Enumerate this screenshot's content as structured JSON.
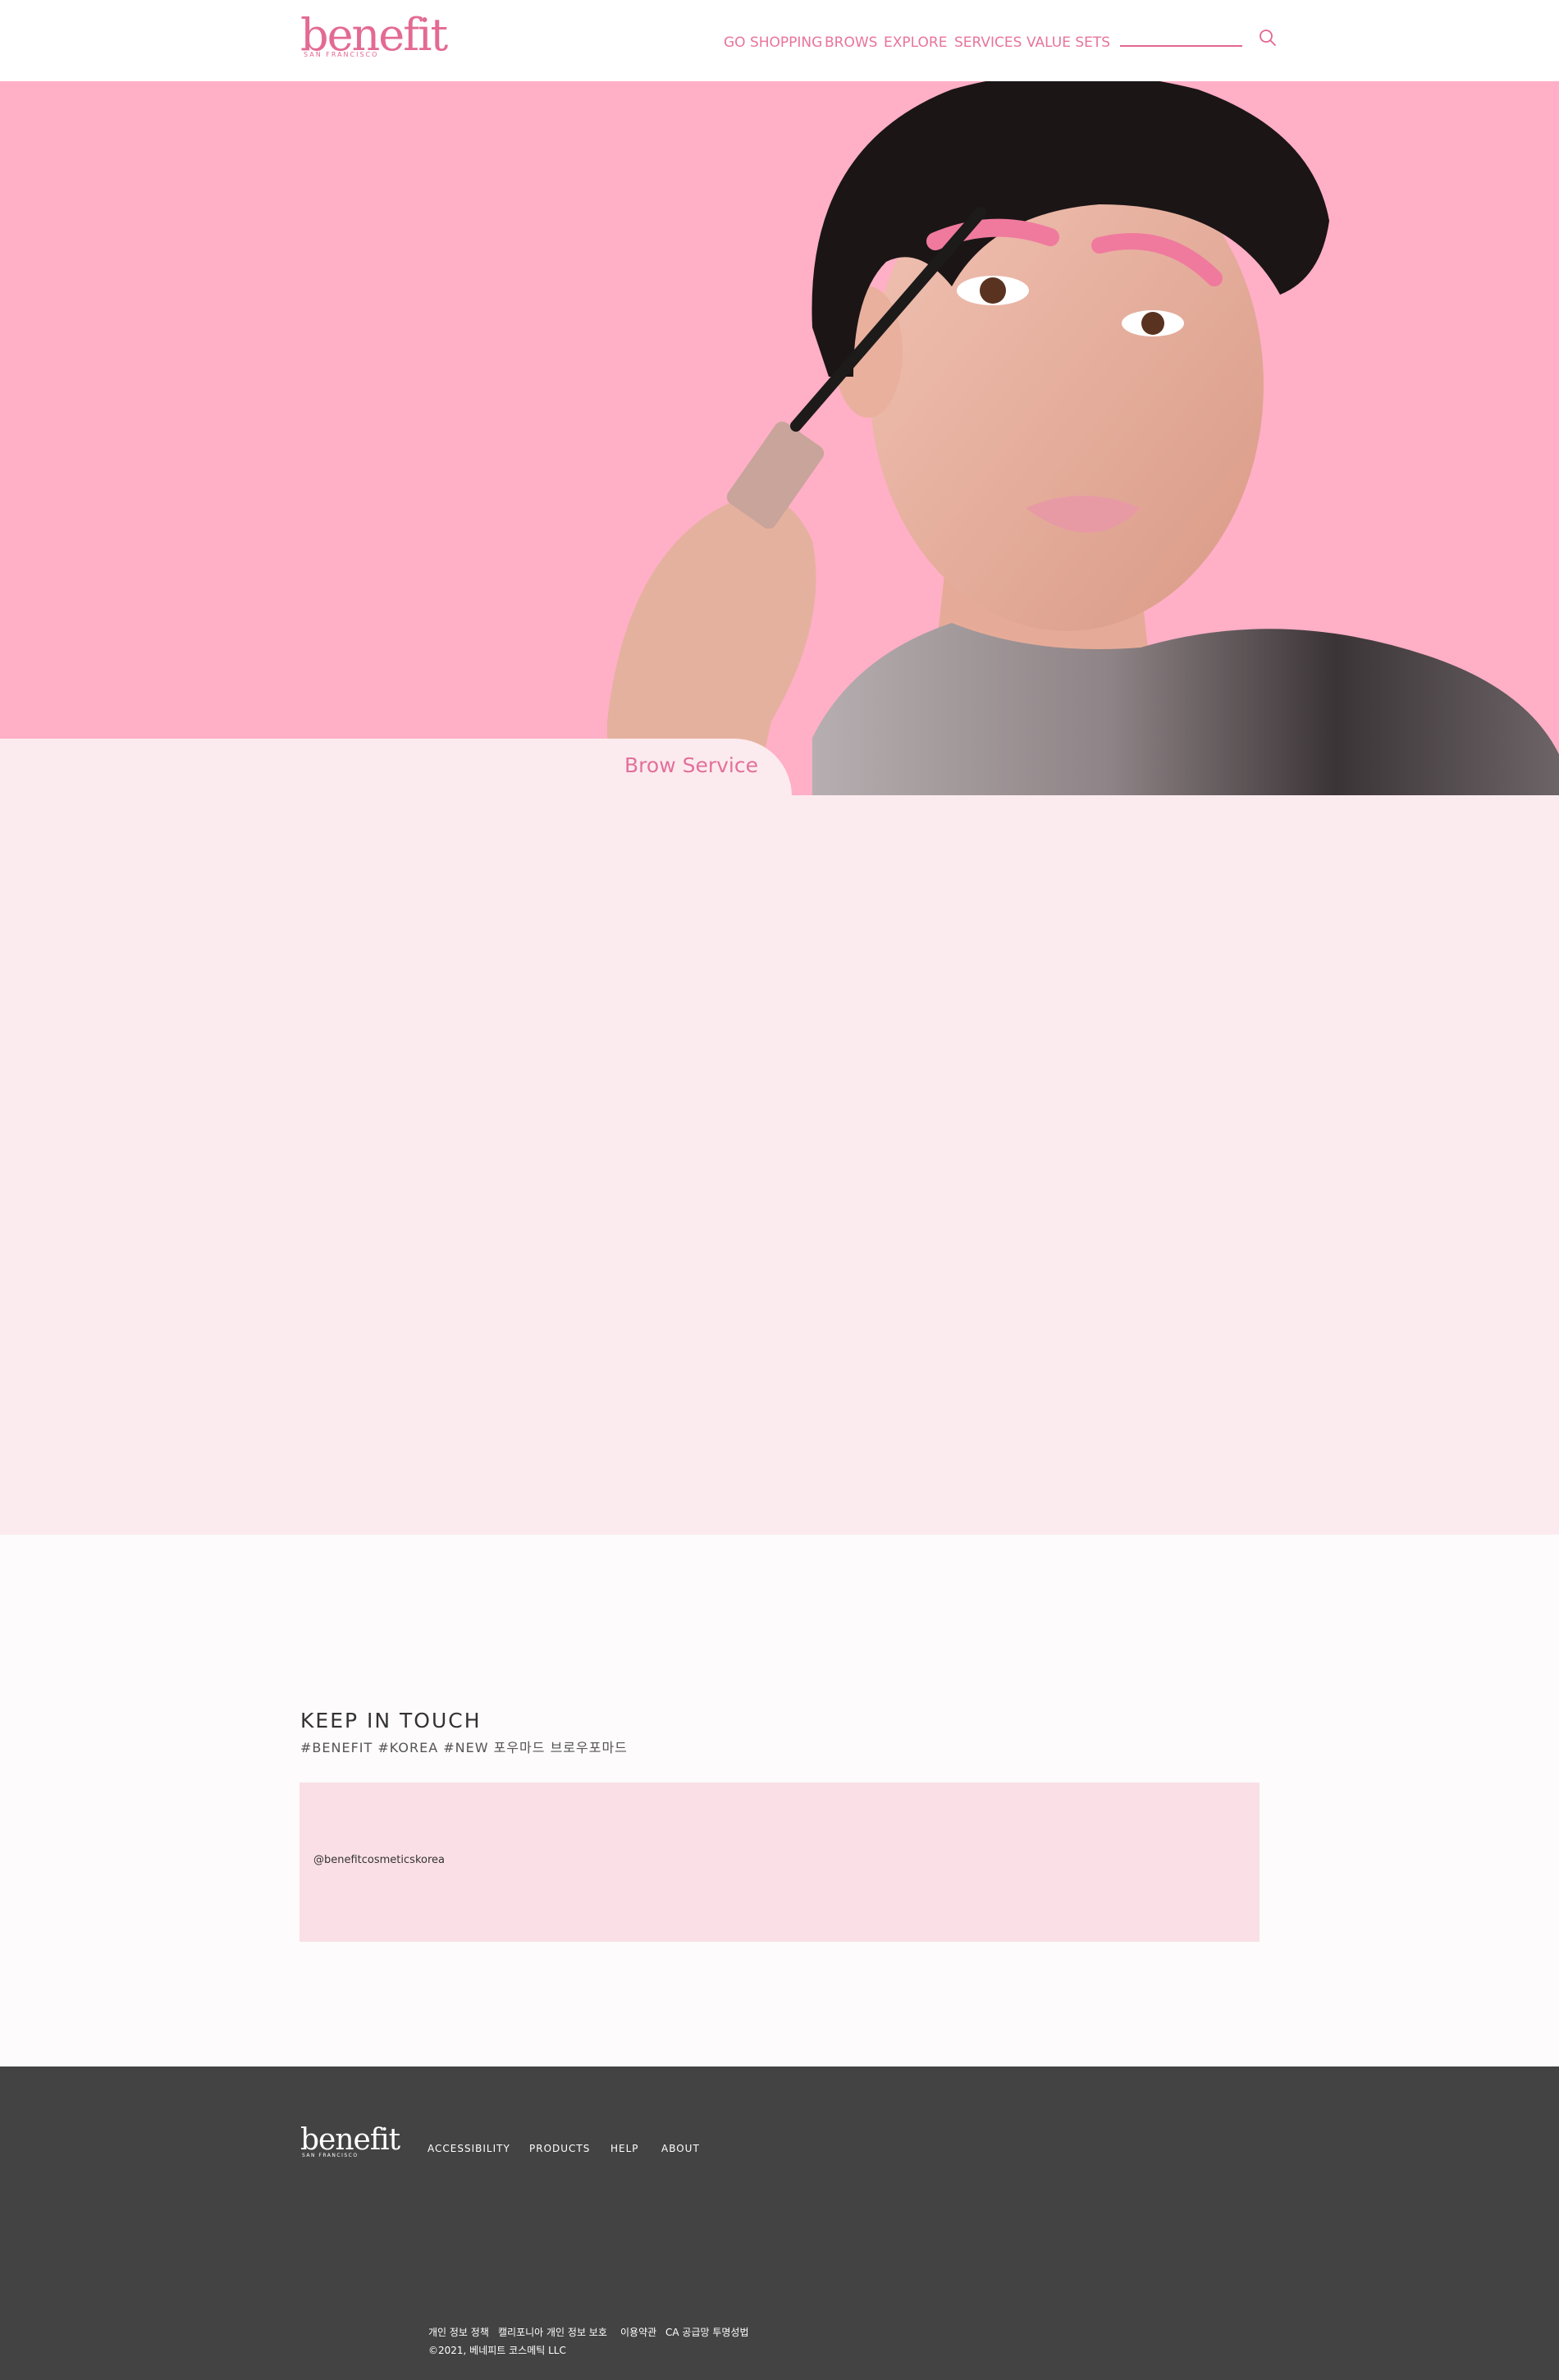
{
  "header": {
    "logo": {
      "word": "benefit",
      "sub": "SAN FRANCISCO"
    },
    "nav": [
      "GO SHOPPING",
      "BROWS",
      "EXPLORE",
      "SERVICES",
      "VALUE SETS"
    ],
    "search": {
      "placeholder": "",
      "icon": "search-icon"
    }
  },
  "hero": {
    "tab_label": "Brow Service",
    "background_color": "#ffafc6"
  },
  "social": {
    "title": "KEEP IN TOUCH",
    "hashtags": "#BENEFIT #KOREA #NEW 포우마드 브로우포마드",
    "handle": "@benefitcosmeticskorea"
  },
  "footer": {
    "logo": {
      "word": "benefit",
      "sub": "SAN FRANCISCO"
    },
    "links": [
      "ACCESSIBILITY",
      "PRODUCTS",
      "HELP",
      "ABOUT"
    ],
    "legal": [
      "개인 정보 정책",
      "캘리포니아 개인 정보 보호",
      "이용약관",
      "CA 공급망 투명성법"
    ],
    "copyright": "©2021, 베네피트 코스메틱 LLC"
  },
  "colors": {
    "brand_pink": "#e36a93",
    "hero_pink": "#ffafc6",
    "panel_pink": "#fbebef",
    "footer_gray": "#434343"
  }
}
